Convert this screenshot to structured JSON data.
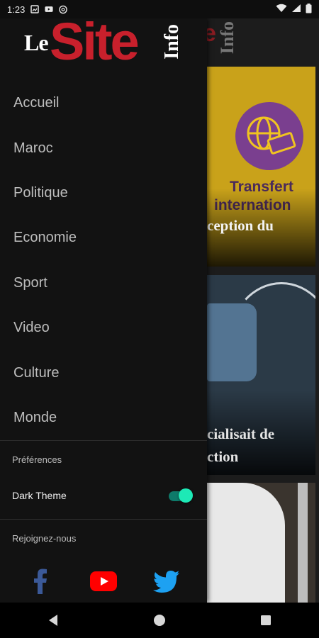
{
  "status_bar": {
    "time": "1:23",
    "left_icons": [
      "gallery-icon",
      "youtube-icon",
      "at-sign-icon"
    ],
    "right_icons": [
      "wifi-icon",
      "signal-icon",
      "battery-icon"
    ]
  },
  "drawer": {
    "logo": {
      "le": "Le",
      "site": "Site",
      "info": "Info"
    },
    "menu_items": [
      {
        "label": "Accueil"
      },
      {
        "label": "Maroc"
      },
      {
        "label": "Politique"
      },
      {
        "label": "Economie"
      },
      {
        "label": "Sport"
      },
      {
        "label": "Video"
      },
      {
        "label": "Culture"
      },
      {
        "label": "Monde"
      }
    ],
    "preferences": {
      "section_label": "Préférences",
      "dark_theme_label": "Dark Theme",
      "dark_theme_on": true
    },
    "join": {
      "section_label": "Rejoignez-nous",
      "socials": [
        {
          "icon": "facebook-icon",
          "color": "#3b5998"
        },
        {
          "icon": "youtube-icon",
          "color": "#ff0000"
        },
        {
          "icon": "twitter-icon",
          "color": "#1da1f2"
        }
      ]
    }
  },
  "background": {
    "logo_fragment": "Info",
    "cards": [
      {
        "image_text_line1": "Transfert",
        "image_text_line2": "internation",
        "headline": "ception du"
      },
      {
        "headline_line1": "cialisait de",
        "headline_line2": "ction"
      },
      {
        "headline": ""
      }
    ]
  },
  "colors": {
    "accent_red": "#c8202c",
    "toggle_on": "#1de9b6",
    "drawer_bg": "#121212"
  },
  "nav_bar": {
    "buttons": [
      "back-icon",
      "home-icon",
      "recents-icon"
    ]
  }
}
